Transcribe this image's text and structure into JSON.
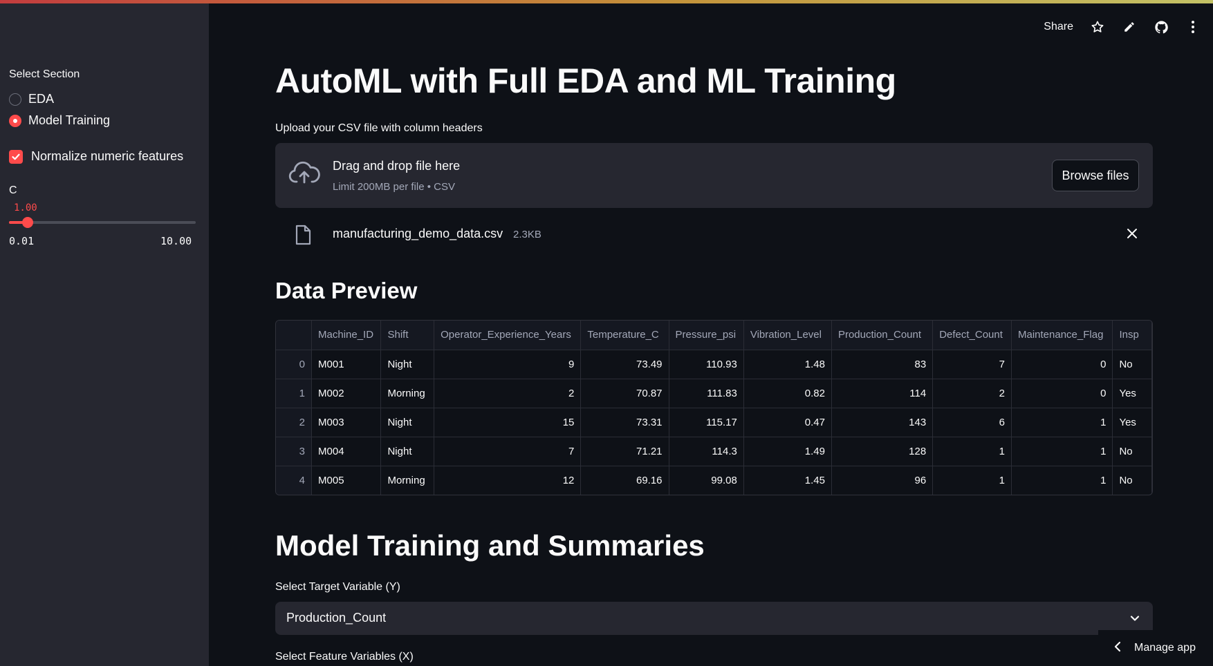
{
  "sidebar": {
    "section_label": "Select Section",
    "options": [
      {
        "label": "EDA",
        "selected": false
      },
      {
        "label": "Model Training",
        "selected": true
      }
    ],
    "normalize_label": "Normalize numeric features",
    "normalize_checked": true,
    "slider": {
      "label": "C",
      "value_text": "1.00",
      "min_text": "0.01",
      "max_text": "10.00",
      "value": 1.0,
      "min": 0.01,
      "max": 10.0
    }
  },
  "toolbar": {
    "share_label": "Share",
    "icons": [
      "star-icon",
      "edit-icon",
      "github-icon",
      "more-icon"
    ]
  },
  "main": {
    "title": "AutoML with Full EDA and ML Training",
    "uploader": {
      "label": "Upload your CSV file with column headers",
      "drop_title": "Drag and drop file here",
      "drop_sub": "Limit 200MB per file • CSV",
      "browse_label": "Browse files"
    },
    "file": {
      "name": "manufacturing_demo_data.csv",
      "size": "2.3KB"
    },
    "preview_heading": "Data Preview",
    "table": {
      "columns": [
        "",
        "Machine_ID",
        "Shift",
        "Operator_Experience_Years",
        "Temperature_C",
        "Pressure_psi",
        "Vibration_Level",
        "Production_Count",
        "Defect_Count",
        "Maintenance_Flag",
        "Insp"
      ],
      "rows": [
        [
          "0",
          "M001",
          "Night",
          "9",
          "73.49",
          "110.93",
          "1.48",
          "83",
          "7",
          "0",
          "No"
        ],
        [
          "1",
          "M002",
          "Morning",
          "2",
          "70.87",
          "111.83",
          "0.82",
          "114",
          "2",
          "0",
          "Yes"
        ],
        [
          "2",
          "M003",
          "Night",
          "15",
          "73.31",
          "115.17",
          "0.47",
          "143",
          "6",
          "1",
          "Yes"
        ],
        [
          "3",
          "M004",
          "Night",
          "7",
          "71.21",
          "114.3",
          "1.49",
          "128",
          "1",
          "1",
          "No"
        ],
        [
          "4",
          "M005",
          "Morning",
          "12",
          "69.16",
          "99.08",
          "1.45",
          "96",
          "1",
          "1",
          "No"
        ]
      ]
    },
    "training_heading": "Model Training and Summaries",
    "target": {
      "label": "Select Target Variable (Y)",
      "value": "Production_Count"
    },
    "features_label": "Select Feature Variables (X)"
  },
  "manage_app_label": "Manage app",
  "colors": {
    "accent": "#ff4b4b",
    "background": "#0e1117",
    "sidebar": "#262730"
  }
}
